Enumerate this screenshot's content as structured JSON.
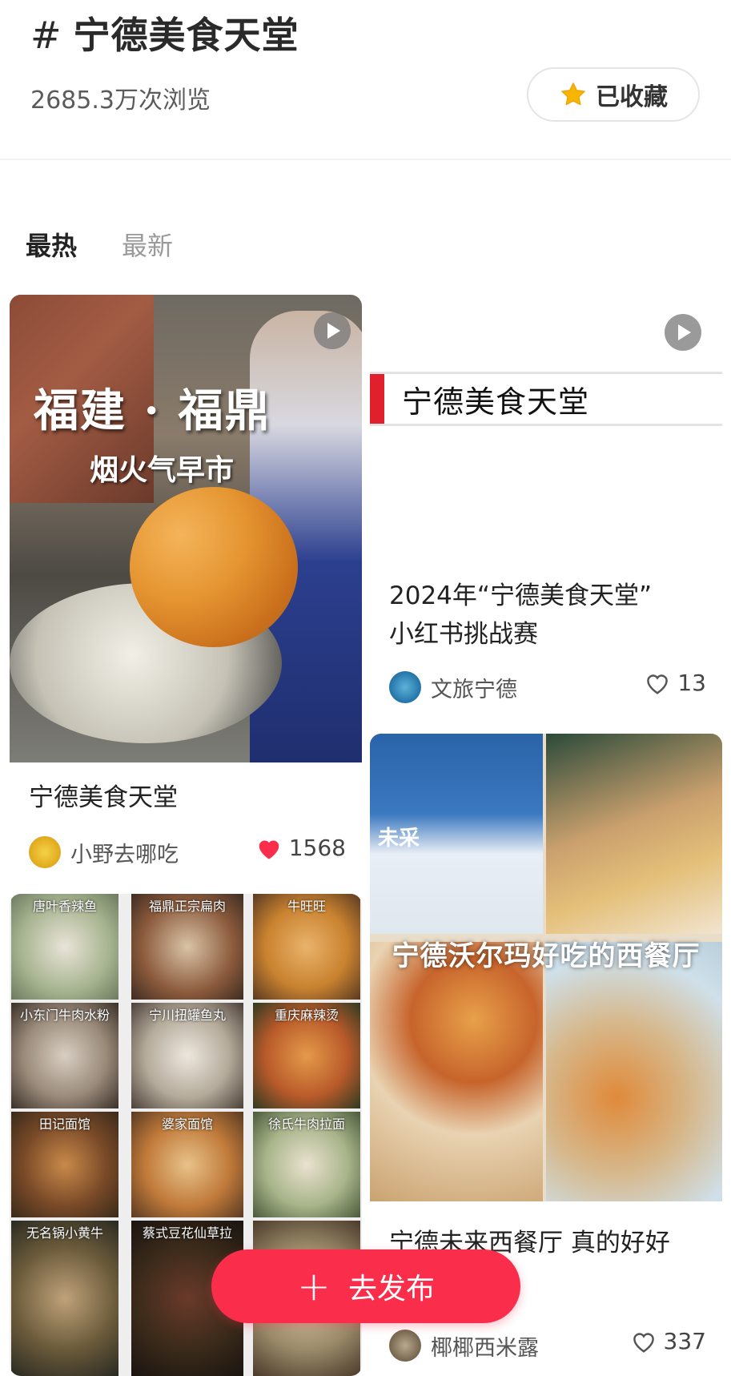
{
  "header": {
    "hash": "#",
    "title": "宁德美食天堂",
    "views": "2685.3万次浏览",
    "fav_label": "已收藏"
  },
  "tabs": [
    {
      "label": "最热"
    },
    {
      "label": "最新"
    }
  ],
  "cards": [
    {
      "cover_text": "福建 · 福鼎",
      "cover_subtext": "烟火气早市",
      "title": "宁德美食天堂",
      "author": "小野去哪吃",
      "likes": "1568",
      "liked": true
    },
    {
      "cover_text": "宁德美食天堂",
      "title_line1": "2024年“宁德美食天堂”",
      "title_line2": "小红书挑战赛",
      "author": "文旅宁德",
      "likes": "13",
      "liked": false
    },
    {
      "cover_shop": "未采",
      "cover_text": "宁德沃尔玛好吃的西餐厅",
      "title": "宁德未来西餐厅 真的好好",
      "author": "椰椰西米露",
      "likes": "337",
      "liked": false
    },
    {
      "cells": [
        "唐叶香辣鱼",
        "福鼎正宗扁肉",
        "牛旺旺",
        "小东门牛肉水粉",
        "宁川扭罐鱼丸",
        "重庆麻辣烫",
        "田记面馆",
        "婆家面馆",
        "徐氏牛肉拉面",
        "无名锅小黄牛",
        "蔡式豆花仙草拉",
        ""
      ]
    }
  ],
  "publish": {
    "plus": "+",
    "label": "去发布"
  },
  "colors": {
    "accent": "#fa2d4b",
    "star": "#f7b500"
  }
}
